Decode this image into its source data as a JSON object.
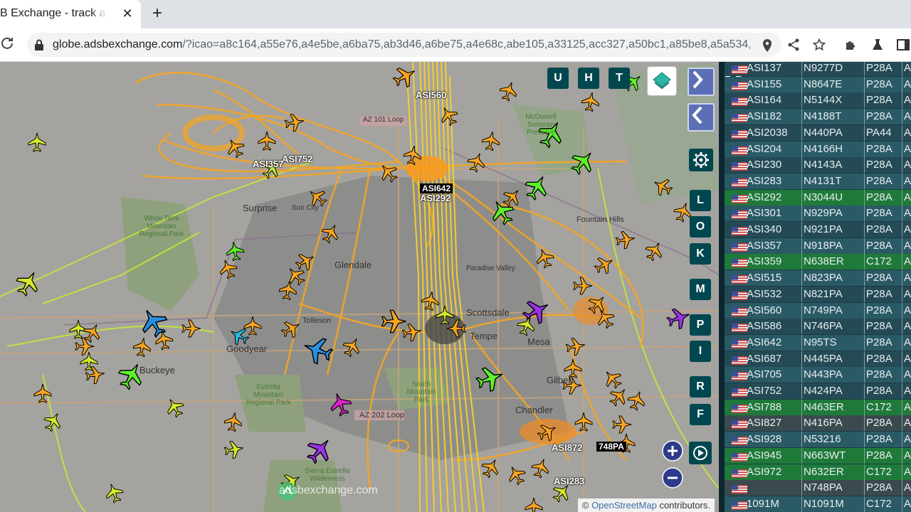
{
  "browser": {
    "tab_title": "B Exchange - track a",
    "tab_close": "✕",
    "new_tab": "+",
    "url_host": "globe.adsbexchange.com",
    "url_rest": "/?icao=a8c164,a55e76,a4e5be,a6ba75,ab3d46,a6be75,a4e68c,abe105,a33125,acc327,a50bc1,a85be8,a5a534,..."
  },
  "map": {
    "attribution_prefix": "©",
    "attribution_link": "OpenStreetMap",
    "attribution_suffix": " contributors.",
    "watermark": "adsbexchange.com",
    "top_buttons": [
      "U",
      "H",
      "T"
    ],
    "side_buttons": [
      "L",
      "O",
      "K",
      "M",
      "P",
      "I",
      "R",
      "F"
    ],
    "places": {
      "surprise": "Surprise",
      "sun_city": "Sun City",
      "glendale": "Glendale",
      "scottsdale": "Scottsdale",
      "mesa": "Mesa",
      "tempe": "Tempe",
      "chandler": "Chandler",
      "goodyear": "Goodyear",
      "buckeye": "Buckeye",
      "tolleson": "Tolleson",
      "fountain_hills": "Fountain Hills",
      "paradise_valley": "Paradise Valley",
      "gilbert": "Gilbert",
      "az101": "AZ 101 Loop",
      "az202": "AZ 202 Loop",
      "white_tank": "White Tank Mountain Regional Park",
      "estrella": "Estrella Mountain Regional Park",
      "south_mountain": "South Mountain Park",
      "sierra_estrella": "Sierra Estrella Wilderness",
      "mcdowell": "McDowell Sonoran Preserve"
    },
    "flight_labels": {
      "asi560": "ASI560",
      "asi752": "ASI752",
      "asi357": "ASI357",
      "asi642": "ASI642",
      "asi292": "ASI292",
      "asi872": "ASI872",
      "n748pa": "748PA",
      "asi283": "ASI283"
    }
  },
  "table": {
    "rows": [
      {
        "callsign": "ASI137",
        "reg": "N9277D",
        "type": "P28A",
        "extra": "A",
        "style": "dark"
      },
      {
        "callsign": "ASI155",
        "reg": "N8647E",
        "type": "P28A",
        "extra": "A",
        "style": "alt"
      },
      {
        "callsign": "ASI164",
        "reg": "N5144X",
        "type": "P28A",
        "extra": "A",
        "style": "dark"
      },
      {
        "callsign": "ASI182",
        "reg": "N4188T",
        "type": "P28A",
        "extra": "A",
        "style": "alt"
      },
      {
        "callsign": "ASI2038",
        "reg": "N440PA",
        "type": "PA44",
        "extra": "A",
        "style": "dark"
      },
      {
        "callsign": "ASI204",
        "reg": "N4166H",
        "type": "P28A",
        "extra": "A",
        "style": "alt"
      },
      {
        "callsign": "ASI230",
        "reg": "N4143A",
        "type": "P28A",
        "extra": "A",
        "style": "dark"
      },
      {
        "callsign": "ASI283",
        "reg": "N4131T",
        "type": "P28A",
        "extra": "A",
        "style": "alt"
      },
      {
        "callsign": "ASI292",
        "reg": "N3044U",
        "type": "P28A",
        "extra": "A",
        "style": "green"
      },
      {
        "callsign": "ASI301",
        "reg": "N929PA",
        "type": "P28A",
        "extra": "A",
        "style": "alt"
      },
      {
        "callsign": "ASI340",
        "reg": "N921PA",
        "type": "P28A",
        "extra": "A",
        "style": "dark"
      },
      {
        "callsign": "ASI357",
        "reg": "N918PA",
        "type": "P28A",
        "extra": "A",
        "style": "alt"
      },
      {
        "callsign": "ASI359",
        "reg": "N638ER",
        "type": "C172",
        "extra": "A",
        "style": "green"
      },
      {
        "callsign": "ASI515",
        "reg": "N823PA",
        "type": "P28A",
        "extra": "A",
        "style": "alt"
      },
      {
        "callsign": "ASI532",
        "reg": "N821PA",
        "type": "P28A",
        "extra": "A",
        "style": "dark"
      },
      {
        "callsign": "ASI560",
        "reg": "N749PA",
        "type": "P28A",
        "extra": "A",
        "style": "alt"
      },
      {
        "callsign": "ASI586",
        "reg": "N746PA",
        "type": "P28A",
        "extra": "A",
        "style": "dark"
      },
      {
        "callsign": "ASI642",
        "reg": "N95TS",
        "type": "P28A",
        "extra": "A",
        "style": "alt"
      },
      {
        "callsign": "ASI687",
        "reg": "N445PA",
        "type": "P28A",
        "extra": "A",
        "style": "dark"
      },
      {
        "callsign": "ASI705",
        "reg": "N443PA",
        "type": "P28A",
        "extra": "A",
        "style": "alt"
      },
      {
        "callsign": "ASI752",
        "reg": "N424PA",
        "type": "P28A",
        "extra": "A",
        "style": "dark"
      },
      {
        "callsign": "ASI788",
        "reg": "N463ER",
        "type": "C172",
        "extra": "A",
        "style": "green"
      },
      {
        "callsign": "ASI827",
        "reg": "N416PA",
        "type": "P28A",
        "extra": "A",
        "style": "grey"
      },
      {
        "callsign": "ASI928",
        "reg": "N53216",
        "type": "P28A",
        "extra": "A",
        "style": "alt"
      },
      {
        "callsign": "ASI945",
        "reg": "N663WT",
        "type": "P28A",
        "extra": "A",
        "style": "green"
      },
      {
        "callsign": "ASI972",
        "reg": "N632ER",
        "type": "C172",
        "extra": "A",
        "style": "green"
      },
      {
        "callsign": "",
        "reg": "N748PA",
        "type": "P28A",
        "extra": "A",
        "style": "grey"
      },
      {
        "callsign": "1091M",
        "reg": "N1091M",
        "type": "C172",
        "extra": "A",
        "style": "alt"
      }
    ]
  }
}
